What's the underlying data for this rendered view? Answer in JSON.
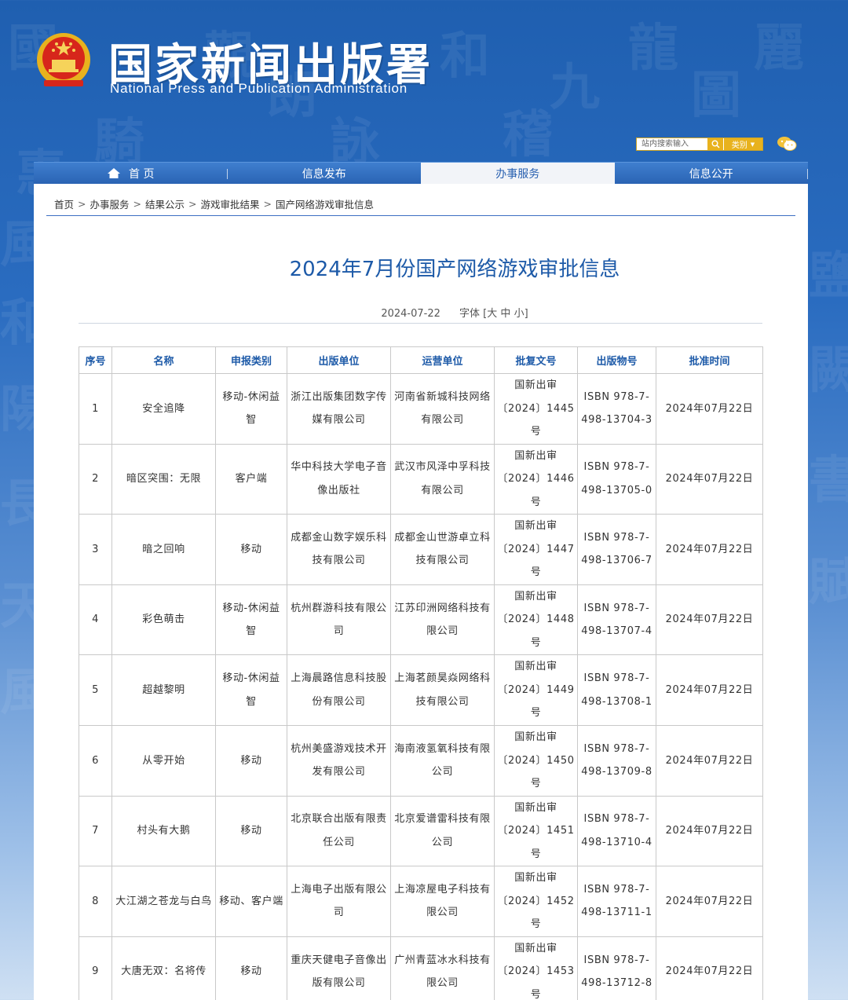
{
  "header": {
    "title": "国家新闻出版署",
    "subtitle": "National  Press and Publication Administration",
    "search_placeholder": "站内搜索输入",
    "category_label": "类别",
    "icons": {
      "emblem": "national-emblem-icon",
      "search": "search-icon",
      "wechat": "wechat-icon",
      "home": "home-icon",
      "dropdown": "caret-down-icon"
    }
  },
  "nav": {
    "items": [
      {
        "label": "首 页"
      },
      {
        "label": "信息发布"
      },
      {
        "label": "办事服务"
      },
      {
        "label": "信息公开"
      }
    ]
  },
  "breadcrumb": {
    "items": [
      "首页",
      "办事服务",
      "结果公示",
      "游戏审批结果",
      "国产网络游戏审批信息"
    ],
    "separator": ">"
  },
  "article": {
    "title": "2024年7月份国产网络游戏审批信息",
    "date": "2024-07-22",
    "font_label": "字体 [",
    "font_large": "大",
    "font_medium": "中",
    "font_small": "小",
    "font_close": "]"
  },
  "table": {
    "headers": [
      "序号",
      "名称",
      "申报类别",
      "出版单位",
      "运营单位",
      "批复文号",
      "出版物号",
      "批准时间"
    ],
    "rows": [
      [
        "1",
        "安全追降",
        "移动-休闲益智",
        "浙江出版集团数字传媒有限公司",
        "河南省新城科技网络有限公司",
        "国新出审〔2024〕1445号",
        "ISBN 978-7-498-13704-3",
        "2024年07月22日"
      ],
      [
        "2",
        "暗区突围：无限",
        "客户端",
        "华中科技大学电子音像出版社",
        "武汉市风泽中孚科技有限公司",
        "国新出审〔2024〕1446号",
        "ISBN 978-7-498-13705-0",
        "2024年07月22日"
      ],
      [
        "3",
        "暗之回响",
        "移动",
        "成都金山数字娱乐科技有限公司",
        "成都金山世游卓立科技有限公司",
        "国新出审〔2024〕1447号",
        "ISBN 978-7-498-13706-7",
        "2024年07月22日"
      ],
      [
        "4",
        "彩色萌击",
        "移动-休闲益智",
        "杭州群游科技有限公司",
        "江苏印洲网络科技有限公司",
        "国新出审〔2024〕1448号",
        "ISBN 978-7-498-13707-4",
        "2024年07月22日"
      ],
      [
        "5",
        "超越黎明",
        "移动-休闲益智",
        "上海晨路信息科技股份有限公司",
        "上海茗颜昊焱网络科技有限公司",
        "国新出审〔2024〕1449号",
        "ISBN 978-7-498-13708-1",
        "2024年07月22日"
      ],
      [
        "6",
        "从零开始",
        "移动",
        "杭州美盛游戏技术开发有限公司",
        "海南液氢氧科技有限公司",
        "国新出审〔2024〕1450号",
        "ISBN 978-7-498-13709-8",
        "2024年07月22日"
      ],
      [
        "7",
        "村头有大鹅",
        "移动",
        "北京联合出版有限责任公司",
        "北京爱谱雷科技有限公司",
        "国新出审〔2024〕1451号",
        "ISBN 978-7-498-13710-4",
        "2024年07月22日"
      ],
      [
        "8",
        "大江湖之苍龙与白鸟",
        "移动、客户端",
        "上海电子出版有限公司",
        "上海凉屋电子科技有限公司",
        "国新出审〔2024〕1452号",
        "ISBN 978-7-498-13711-1",
        "2024年07月22日"
      ],
      [
        "9",
        "大唐无双：名将传",
        "移动",
        "重庆天健电子音像出版有限公司",
        "广州青蓝冰水科技有限公司",
        "国新出审〔2024〕1453号",
        "ISBN 978-7-498-13712-8",
        "2024年07月22日"
      ]
    ]
  }
}
